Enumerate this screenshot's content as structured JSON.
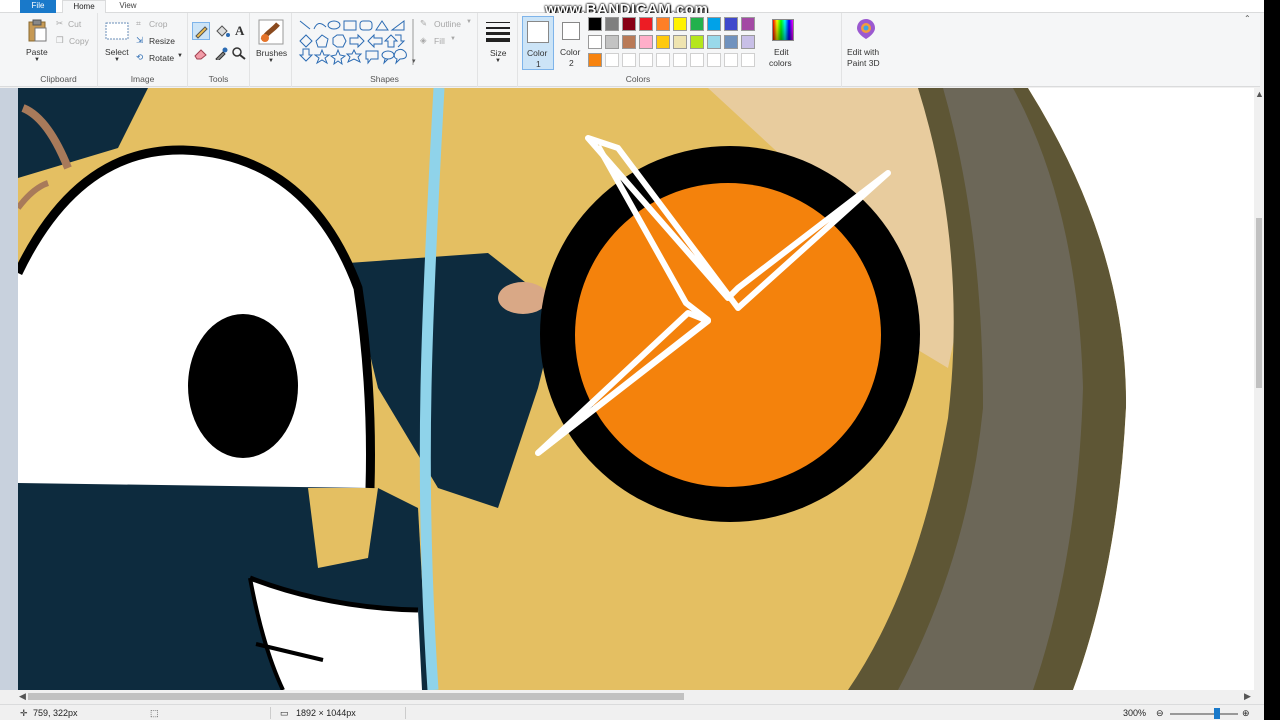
{
  "tabs": {
    "file": "File",
    "home": "Home",
    "view": "View"
  },
  "watermark": "www.BANDICAM.com",
  "clipboard": {
    "paste": "Paste",
    "cut": "Cut",
    "copy": "Copy",
    "group": "Clipboard"
  },
  "image": {
    "select": "Select",
    "crop": "Crop",
    "resize": "Resize",
    "rotate": "Rotate",
    "group": "Image"
  },
  "tools": {
    "group": "Tools",
    "icons": [
      "pencil-icon",
      "fill-icon",
      "text-icon",
      "eraser-icon",
      "color-picker-icon",
      "magnifier-icon"
    ]
  },
  "brushes": {
    "label": "Brushes"
  },
  "shapes": {
    "outline": "Outline",
    "fill": "Fill",
    "group": "Shapes"
  },
  "size": {
    "label": "Size"
  },
  "colors": {
    "color1": "Color",
    "color1_num": "1",
    "color2": "Color",
    "color2_num": "2",
    "group": "Colors",
    "edit_colors": "Edit",
    "edit_colors_2": "colors",
    "paint3d": "Edit with",
    "paint3d_2": "Paint 3D",
    "color1_value": "#ffffff",
    "color2_value": "#ffffff",
    "palette_row1": [
      "#000000",
      "#7f7f7f",
      "#880015",
      "#ed1c24",
      "#ff7f27",
      "#fff200",
      "#22b14c",
      "#00a2e8",
      "#3f48cc",
      "#a349a4"
    ],
    "palette_row2": [
      "#ffffff",
      "#c3c3c3",
      "#b97a57",
      "#ffaec9",
      "#ffc90e",
      "#efe4b0",
      "#b5e61d",
      "#99d9ea",
      "#7092be",
      "#c8bfe7"
    ],
    "palette_row3": [
      "#f7830f"
    ]
  },
  "status": {
    "cursor": "759, 322px",
    "canvas_size": "1892 × 1044px",
    "zoom": "300%"
  }
}
